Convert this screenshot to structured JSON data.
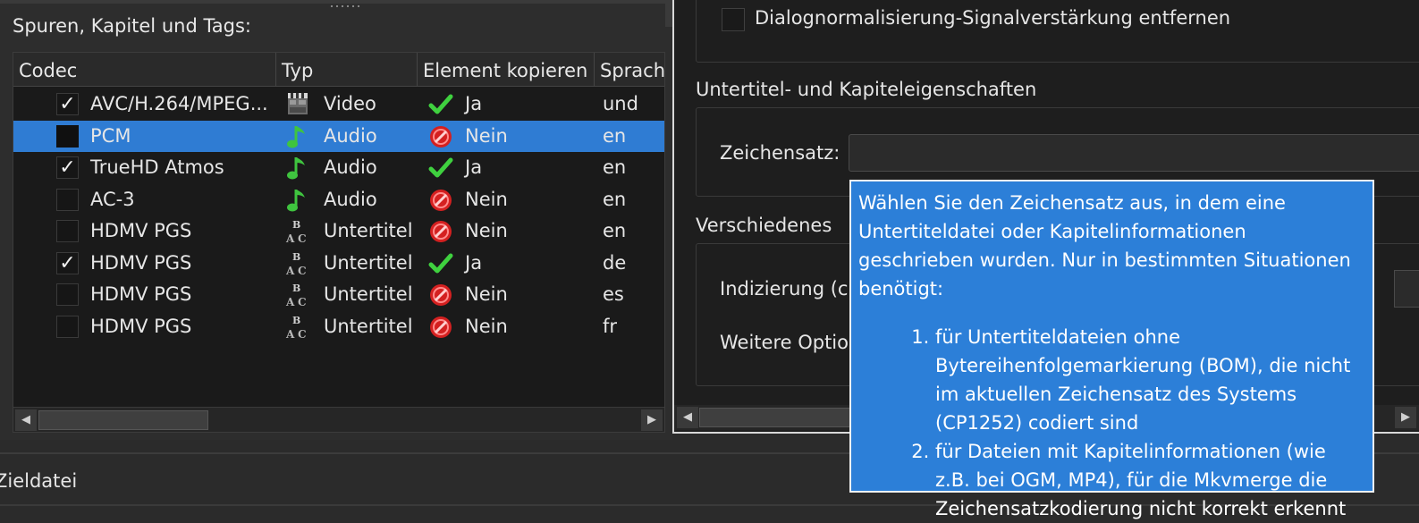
{
  "tracks_section": {
    "label": "Spuren, Kapitel und Tags:",
    "columns": [
      "Codec",
      "Typ",
      "Element kopieren",
      "Sprach"
    ],
    "rows": [
      {
        "checked": true,
        "codec": "AVC/H.264/MPEG...",
        "type": "Video",
        "type_icon": "video-clapper-icon",
        "copy": "Ja",
        "copy_icon": "check-icon",
        "lang": "und",
        "selected": false
      },
      {
        "checked": false,
        "codec": "PCM",
        "type": "Audio",
        "type_icon": "music-note-icon",
        "copy": "Nein",
        "copy_icon": "no-entry-icon",
        "lang": "en",
        "selected": true
      },
      {
        "checked": true,
        "codec": "TrueHD Atmos",
        "type": "Audio",
        "type_icon": "music-note-icon",
        "copy": "Ja",
        "copy_icon": "check-icon",
        "lang": "en",
        "selected": false
      },
      {
        "checked": false,
        "codec": "AC-3",
        "type": "Audio",
        "type_icon": "music-note-icon",
        "copy": "Nein",
        "copy_icon": "no-entry-icon",
        "lang": "en",
        "selected": false
      },
      {
        "checked": false,
        "codec": "HDMV PGS",
        "type": "Untertitel",
        "type_icon": "subtitle-abc-icon",
        "copy": "Nein",
        "copy_icon": "no-entry-icon",
        "lang": "en",
        "selected": false
      },
      {
        "checked": true,
        "codec": "HDMV PGS",
        "type": "Untertitel",
        "type_icon": "subtitle-abc-icon",
        "copy": "Ja",
        "copy_icon": "check-icon",
        "lang": "de",
        "selected": false
      },
      {
        "checked": false,
        "codec": "HDMV PGS",
        "type": "Untertitel",
        "type_icon": "subtitle-abc-icon",
        "copy": "Nein",
        "copy_icon": "no-entry-icon",
        "lang": "es",
        "selected": false
      },
      {
        "checked": false,
        "codec": "HDMV PGS",
        "type": "Untertitel",
        "type_icon": "subtitle-abc-icon",
        "copy": "Nein",
        "copy_icon": "no-entry-icon",
        "lang": "fr",
        "selected": false
      }
    ]
  },
  "properties": {
    "dialog_normalization_label": "Dialognormalisierung-Signalverstärkung entfernen",
    "subtitle_group_title": "Untertitel- und Kapiteleigenschaften",
    "charset_label": "Zeichensatz:",
    "misc_group_title": "Verschiedenes",
    "indexing_label": "Indizierung (cu",
    "more_options_label": "Weitere Optio"
  },
  "tooltip": {
    "intro": "Wählen Sie den Zeichensatz aus, in dem eine Untertiteldatei oder Kapitelinformationen geschrieben wurden. Nur in bestimmten Situationen benötigt:",
    "items": [
      "für Untertiteldateien ohne Bytereihenfolgemarkierung (BOM), die nicht im aktuellen Zeichensatz des Systems (CP1252) codiert sind",
      "für Dateien mit Kapitelinformationen (wie z.B. bei OGM, MP4), für die Mkvmerge die Zeichensatzkodierung nicht korrekt erkennt"
    ]
  },
  "bottom": {
    "output_label": "Zieldatei"
  },
  "colors": {
    "selection": "#2f7cd3",
    "tooltip_bg": "#2c7fd8",
    "check_green": "#3fd13f",
    "no_red": "#d42020"
  }
}
